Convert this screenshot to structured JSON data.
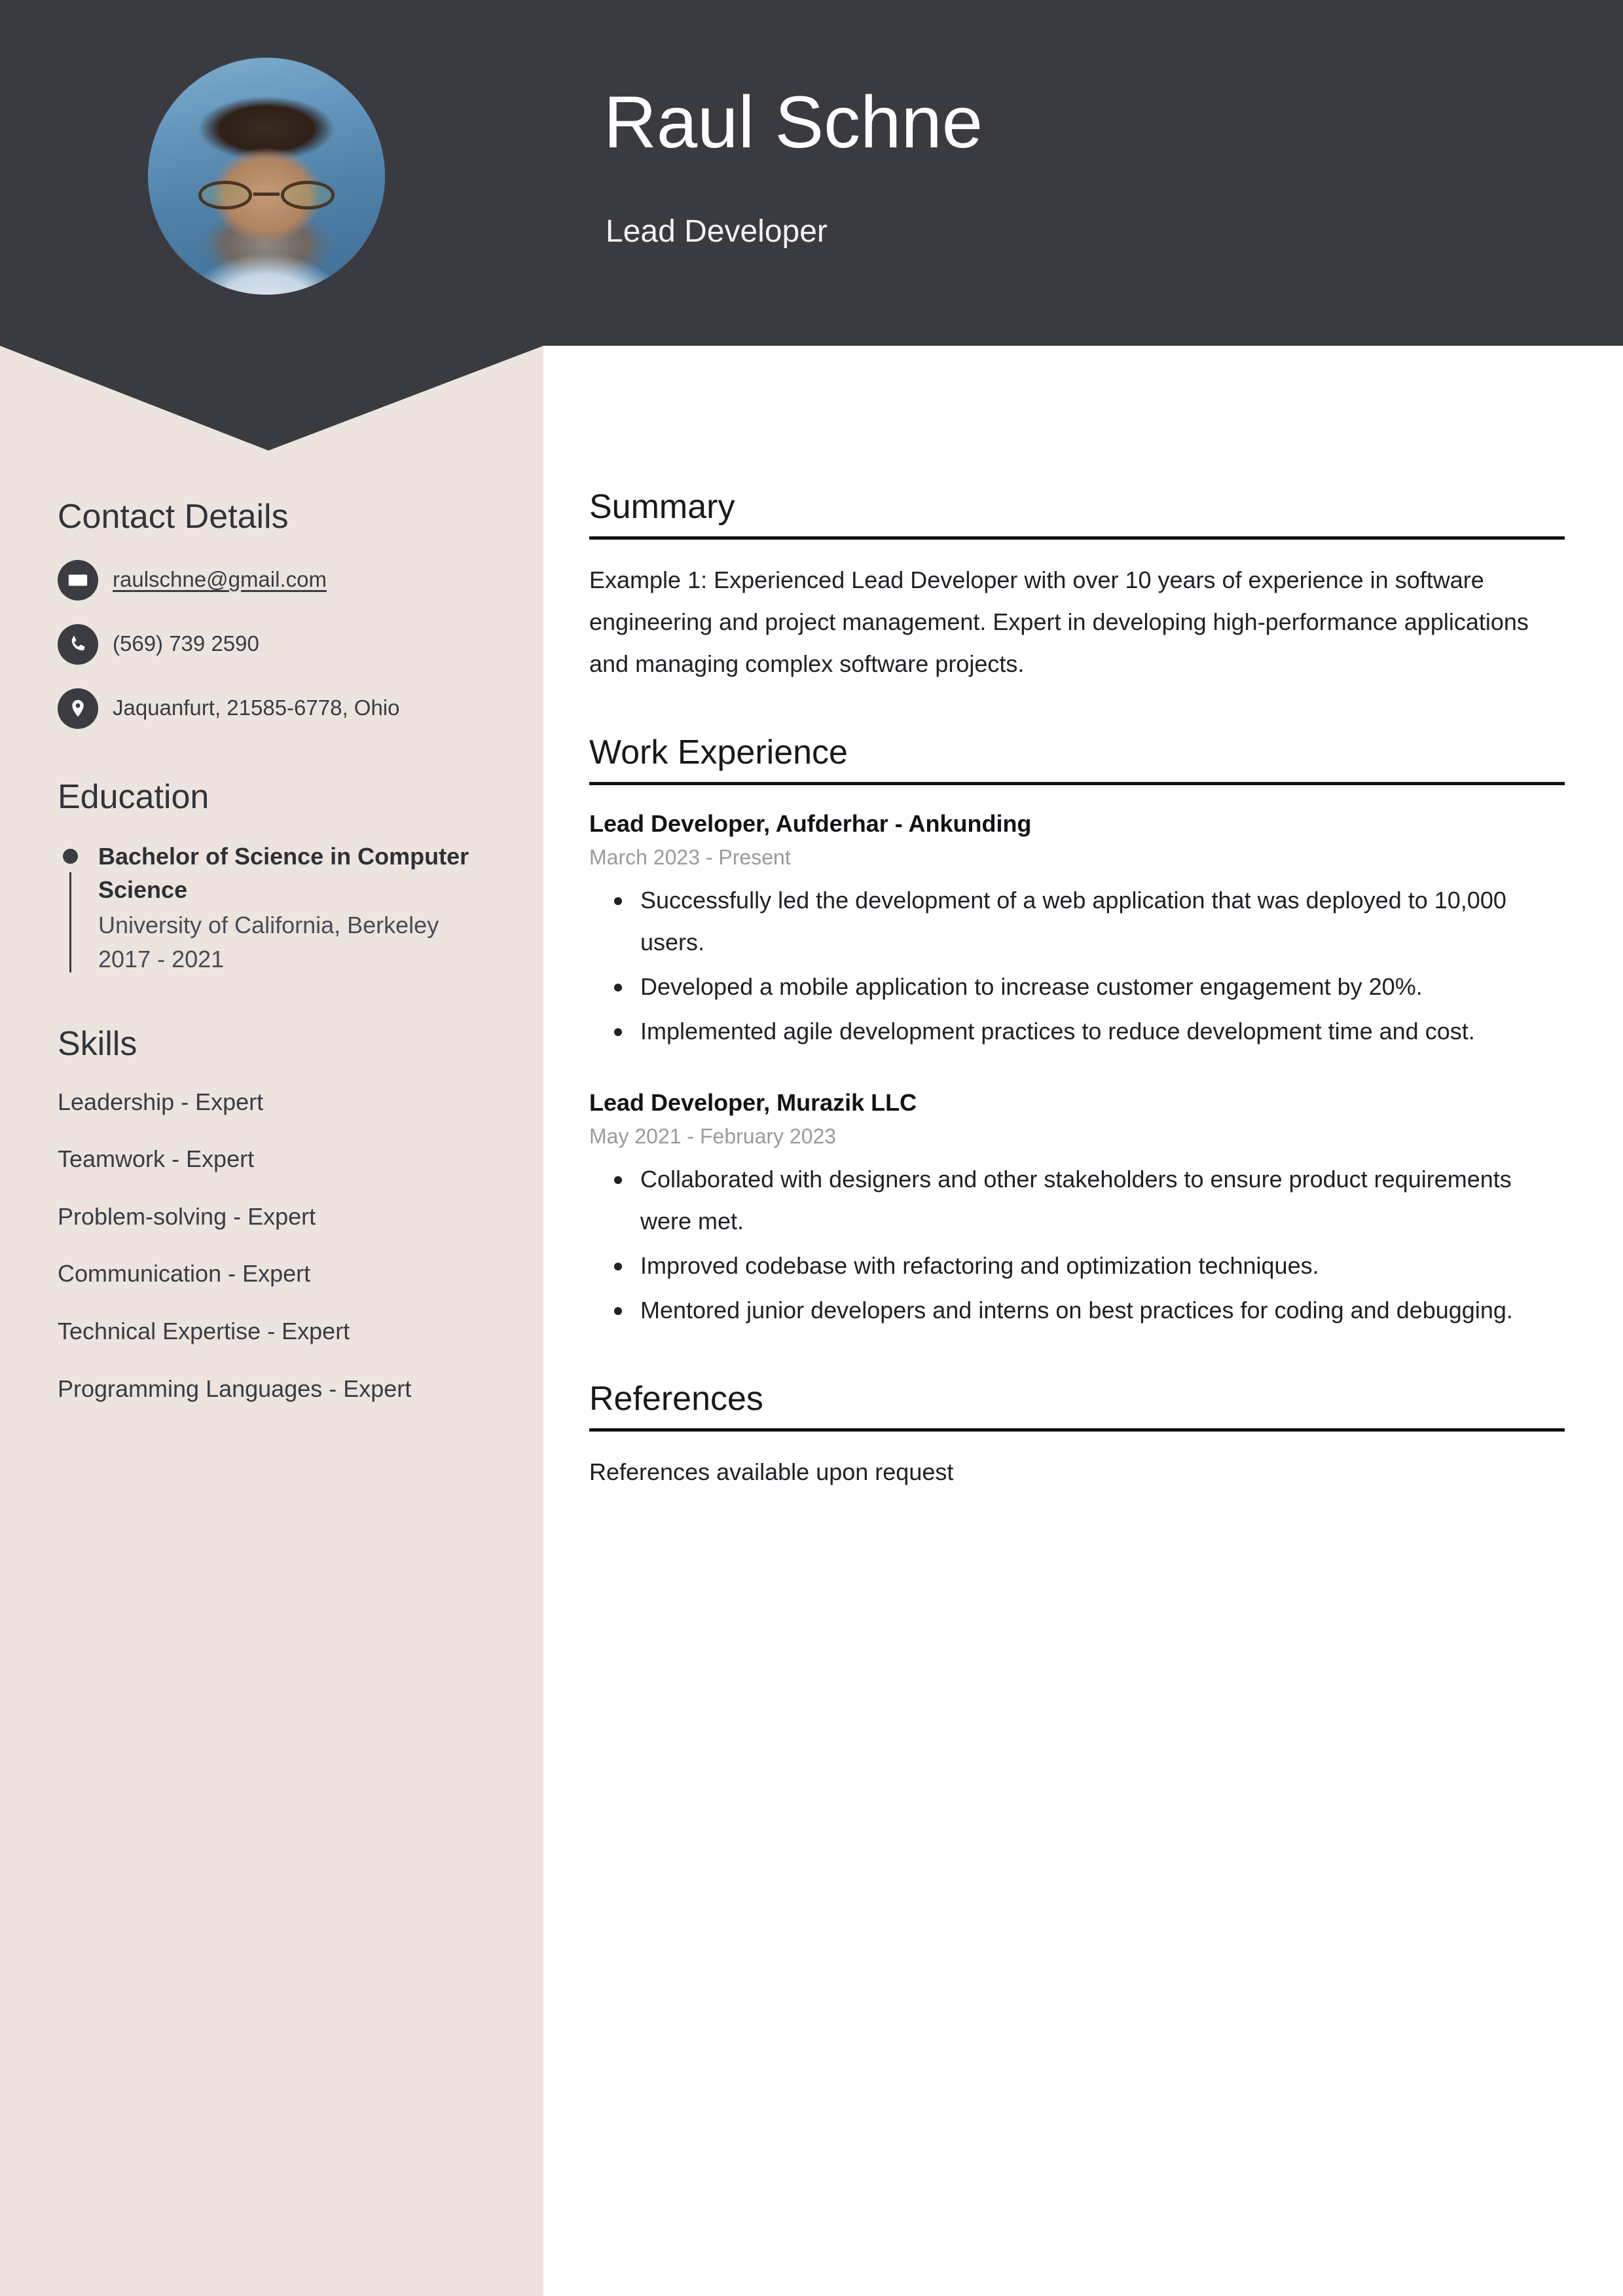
{
  "colors": {
    "header_bg": "#393B40",
    "sidebar_bg": "#EDE4DF",
    "page_bg": "#FFFFFF",
    "text_dark": "#1E2024",
    "muted_text": "#9A9A9C",
    "rule": "#111215"
  },
  "header": {
    "name": "Raul Schne",
    "role": "Lead Developer",
    "avatar_alt": "Profile photo of a bearded man with glasses"
  },
  "sidebar": {
    "contact": {
      "heading": "Contact Details",
      "items": [
        {
          "icon": "email-icon",
          "value": "raulschne@gmail.com",
          "is_link": true
        },
        {
          "icon": "phone-icon",
          "value": "(569) 739 2590",
          "is_link": false
        },
        {
          "icon": "location-icon",
          "value": "Jaquanfurt, 21585-6778, Ohio",
          "is_link": false
        }
      ]
    },
    "education": {
      "heading": "Education",
      "items": [
        {
          "degree": "Bachelor of Science in Computer Science",
          "school": "University of California, Berkeley",
          "dates": "2017 - 2021"
        }
      ]
    },
    "skills": {
      "heading": "Skills",
      "items": [
        "Leadership - Expert",
        "Teamwork - Expert",
        "Problem-solving - Expert",
        "Communication - Expert",
        "Technical Expertise - Expert",
        "Programming Languages - Expert"
      ]
    }
  },
  "main": {
    "summary": {
      "heading": "Summary",
      "text": "Example 1: Experienced Lead Developer with over 10 years of experience in software engineering and project management. Expert in developing high-performance applications and managing complex software projects."
    },
    "work_experience": {
      "heading": "Work Experience",
      "jobs": [
        {
          "title": "Lead Developer, Aufderhar - Ankunding",
          "dates": "March 2023 - Present",
          "bullets": [
            "Successfully led the development of a web application that was deployed to 10,000 users.",
            "Developed a mobile application to increase customer engagement by 20%.",
            "Implemented agile development practices to reduce development time and cost."
          ]
        },
        {
          "title": "Lead Developer, Murazik LLC",
          "dates": "May 2021 - February 2023",
          "bullets": [
            "Collaborated with designers and other stakeholders to ensure product requirements were met.",
            "Improved codebase with refactoring and optimization techniques.",
            "Mentored junior developers and interns on best practices for coding and debugging."
          ]
        }
      ]
    },
    "references": {
      "heading": "References",
      "text": "References available upon request"
    }
  }
}
